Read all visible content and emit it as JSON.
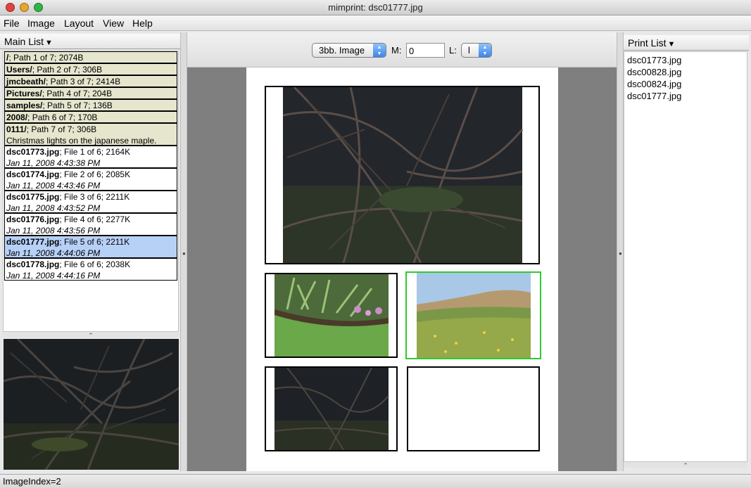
{
  "window": {
    "title": "mimprint: dsc01777.jpg",
    "controls": [
      {
        "name": "close",
        "color": "#e0443e"
      },
      {
        "name": "minimize",
        "color": "#e6a630"
      },
      {
        "name": "zoom",
        "color": "#2fb543"
      }
    ]
  },
  "menubar": {
    "items": [
      "File",
      "Image",
      "Layout",
      "View",
      "Help"
    ]
  },
  "main_list": {
    "header": "Main List",
    "paths": [
      {
        "name": "/",
        "info": "; Path 1 of 7; 2074B"
      },
      {
        "name": "Users/",
        "info": "; Path 2 of 7; 306B"
      },
      {
        "name": "jmcbeath/",
        "info": "; Path 3 of 7; 2414B"
      },
      {
        "name": "Pictures/",
        "info": "; Path 4 of 7; 204B"
      },
      {
        "name": "samples/",
        "info": "; Path 5 of 7; 136B"
      },
      {
        "name": "2008/",
        "info": "; Path 6 of 7; 170B"
      },
      {
        "name": "0111/",
        "info": "; Path 7 of 7; 306B",
        "note": "Christmas lights on the japanese maple."
      }
    ],
    "files": [
      {
        "name": "dsc01773.jpg",
        "info": "; File 1 of 6; 2164K",
        "date": "Jan 11, 2008 4:43:38 PM"
      },
      {
        "name": "dsc01774.jpg",
        "info": "; File 2 of 6; 2085K",
        "date": "Jan 11, 2008 4:43:46 PM"
      },
      {
        "name": "dsc01775.jpg",
        "info": "; File 3 of 6; 2211K",
        "date": "Jan 11, 2008 4:43:52 PM"
      },
      {
        "name": "dsc01776.jpg",
        "info": "; File 4 of 6; 2277K",
        "date": "Jan 11, 2008 4:43:56 PM"
      },
      {
        "name": "dsc01777.jpg",
        "info": "; File 5 of 6; 2211K",
        "date": "Jan 11, 2008 4:44:06 PM"
      },
      {
        "name": "dsc01778.jpg",
        "info": "; File 6 of 6; 2038K",
        "date": "Jan 11, 2008 4:44:16 PM"
      }
    ],
    "selected_index": 4
  },
  "toolbar": {
    "layout_select": "3bb. Image",
    "m_label": "M:",
    "m_value": "0",
    "l_label": "L:",
    "l_value": "l"
  },
  "print_list": {
    "header": "Print List",
    "items": [
      "dsc01773.jpg",
      "dsc00828.jpg",
      "dsc00824.jpg",
      "dsc01777.jpg"
    ]
  },
  "status": {
    "text": "ImageIndex=2"
  },
  "colors": {
    "path_row_bg": "#e6e6cf",
    "selected_row_bg": "#b7d0f6",
    "active_slot_border": "#2ecb2e",
    "canvas_bg": "#7f7f7f"
  }
}
